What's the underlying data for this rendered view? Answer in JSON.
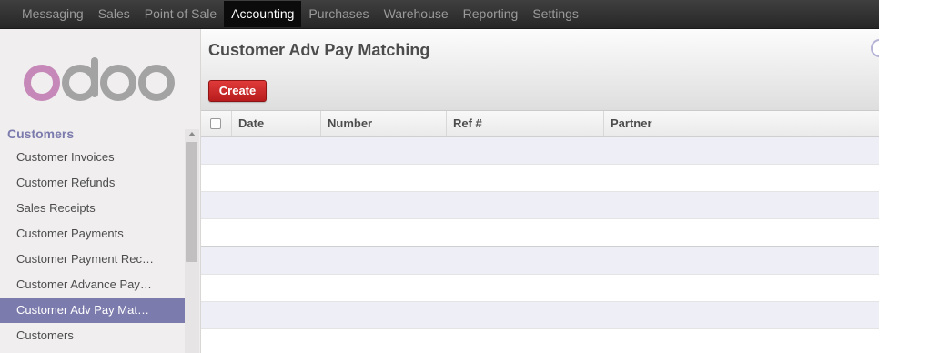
{
  "topnav": {
    "items": [
      {
        "label": "Messaging",
        "active": false
      },
      {
        "label": "Sales",
        "active": false
      },
      {
        "label": "Point of Sale",
        "active": false
      },
      {
        "label": "Accounting",
        "active": true
      },
      {
        "label": "Purchases",
        "active": false
      },
      {
        "label": "Warehouse",
        "active": false
      },
      {
        "label": "Reporting",
        "active": false
      },
      {
        "label": "Settings",
        "active": false
      }
    ]
  },
  "sidebar": {
    "logo": "odoo",
    "section_title": "Customers",
    "items": [
      {
        "label": "Customer Invoices",
        "active": false
      },
      {
        "label": "Customer Refunds",
        "active": false
      },
      {
        "label": "Sales Receipts",
        "active": false
      },
      {
        "label": "Customer Payments",
        "active": false
      },
      {
        "label": "Customer Payment Rec…",
        "active": false
      },
      {
        "label": "Customer Advance Pay…",
        "active": false
      },
      {
        "label": "Customer Adv Pay Mat…",
        "active": true
      },
      {
        "label": "Customers",
        "active": false
      }
    ]
  },
  "main": {
    "title": "Customer Adv Pay Matching",
    "create_label": "Create",
    "columns": [
      "Date",
      "Number",
      "Ref #",
      "Partner"
    ]
  },
  "colors": {
    "accent": "#7c7bad",
    "create_button": "#c42b2b",
    "topbar": "#333333",
    "logo_o": "#c588b8",
    "logo_doo": "#a3a3a3"
  },
  "icons": {
    "select_all": "checkbox-icon",
    "help": "help-circle-icon",
    "scroll_up": "chevron-up-icon"
  }
}
